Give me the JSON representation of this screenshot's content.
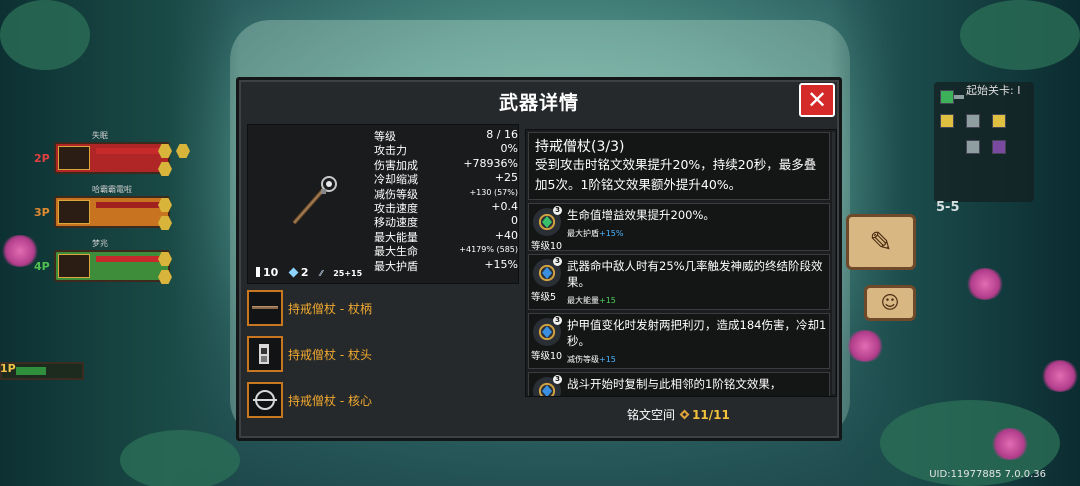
{
  "dialog": {
    "title": "武器详情",
    "close_icon": "close-x-icon"
  },
  "weapon": {
    "icon": "monk-staff-weapon-icon",
    "stats": [
      {
        "label": "等级",
        "value": "8 / 16"
      },
      {
        "label": "攻击力",
        "value": "0%"
      },
      {
        "label": "伤害加成",
        "value": "+78936%"
      },
      {
        "label": "冷却缩减",
        "value": "+25"
      },
      {
        "label": "减伤等级",
        "value": "+130 (57%)",
        "small": true
      },
      {
        "label": "攻击速度",
        "value": "+0.4"
      },
      {
        "label": "移动速度",
        "value": "0"
      },
      {
        "label": "最大能量",
        "value": "+40"
      },
      {
        "label": "最大生命",
        "value": "+4179% (585)",
        "small": true
      },
      {
        "label": "最大护盾",
        "value": "+15%"
      }
    ],
    "footer": {
      "potion_count": "10",
      "crystal_count": "2",
      "crit_text": "25+15"
    }
  },
  "parts": [
    {
      "label": "持戒僧杖 - 杖柄",
      "icon": "staff-handle-icon"
    },
    {
      "label": "持戒僧杖 - 杖头",
      "icon": "staff-head-icon"
    },
    {
      "label": "持戒僧杖 - 核心",
      "icon": "staff-core-icon"
    }
  ],
  "description": {
    "title": "持戒僧杖(3/3)",
    "text": "受到攻击时铭文效果提升20%，持续20秒，最多叠加5次。1阶铭文效果额外提升40%。"
  },
  "inscriptions": [
    {
      "badge": "3",
      "text": "生命值增益效果提升200%。",
      "level": "等级10",
      "sub_label": "最大护盾",
      "sub_value": "+15%",
      "sub_color": "blue",
      "gem_color": "#39c06a"
    },
    {
      "badge": "3",
      "text": "武器命中敌人时有25%几率触发神威的终结阶段效果。",
      "level": "等级5",
      "sub_label": "最大能量",
      "sub_value": "+15",
      "sub_color": "green",
      "gem_color": "#3a8fe0"
    },
    {
      "badge": "3",
      "text": "护甲值变化时发射两把利刃，造成184伤害，冷却1秒。",
      "level": "等级10",
      "sub_label": "减伤等级",
      "sub_value": "+15",
      "sub_color": "blue",
      "gem_color": "#3a8fe0"
    },
    {
      "badge": "3",
      "text": "战斗开始时复制与此相邻的1阶铭文效果，",
      "level": "",
      "sub_label": "",
      "sub_value": "",
      "sub_color": "blue",
      "gem_color": "#3a8fe0"
    }
  ],
  "inscription_space": {
    "label": "铭文空间",
    "value": "11/11"
  },
  "hud": {
    "players": [
      {
        "tag": "2P",
        "name": "失眠",
        "tag_color": "#e04040"
      },
      {
        "tag": "3P",
        "name": "哈霸霸電啦",
        "tag_color": "#e08a30"
      },
      {
        "tag": "4P",
        "name": "梦兆",
        "tag_color": "#4fc04f"
      }
    ],
    "self_tag": "1P",
    "minimap_title": "起始关卡: I",
    "stage": "5-5",
    "uid": "UID:11977885 7.0.0.36"
  }
}
